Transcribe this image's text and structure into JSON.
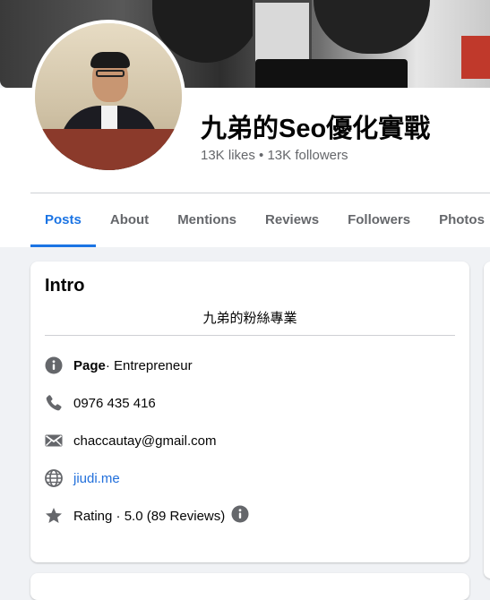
{
  "profile": {
    "name": "九弟的Seo優化實戰",
    "likes": "13K likes",
    "stats_separator": " • ",
    "followers": "13K followers"
  },
  "tabs": [
    {
      "label": "Posts",
      "active": true
    },
    {
      "label": "About",
      "active": false
    },
    {
      "label": "Mentions",
      "active": false
    },
    {
      "label": "Reviews",
      "active": false
    },
    {
      "label": "Followers",
      "active": false
    },
    {
      "label": "Photos",
      "active": false
    }
  ],
  "intro": {
    "title": "Intro",
    "bio": "九弟的粉絲專業",
    "page_label": "Page",
    "page_category": " · Entrepreneur",
    "phone": "0976 435 416",
    "email": "chaccautay@gmail.com",
    "website": "jiudi.me",
    "rating": "Rating · 5.0 (89 Reviews)"
  },
  "icons": {
    "info": "info-icon",
    "phone": "phone-icon",
    "email": "envelope-icon",
    "website": "globe-icon",
    "rating": "star-icon",
    "rating_info": "info-icon"
  },
  "colors": {
    "accent": "#1b74e4",
    "link": "#216fdb",
    "secondary_text": "#65676b",
    "background": "#f0f2f5"
  }
}
